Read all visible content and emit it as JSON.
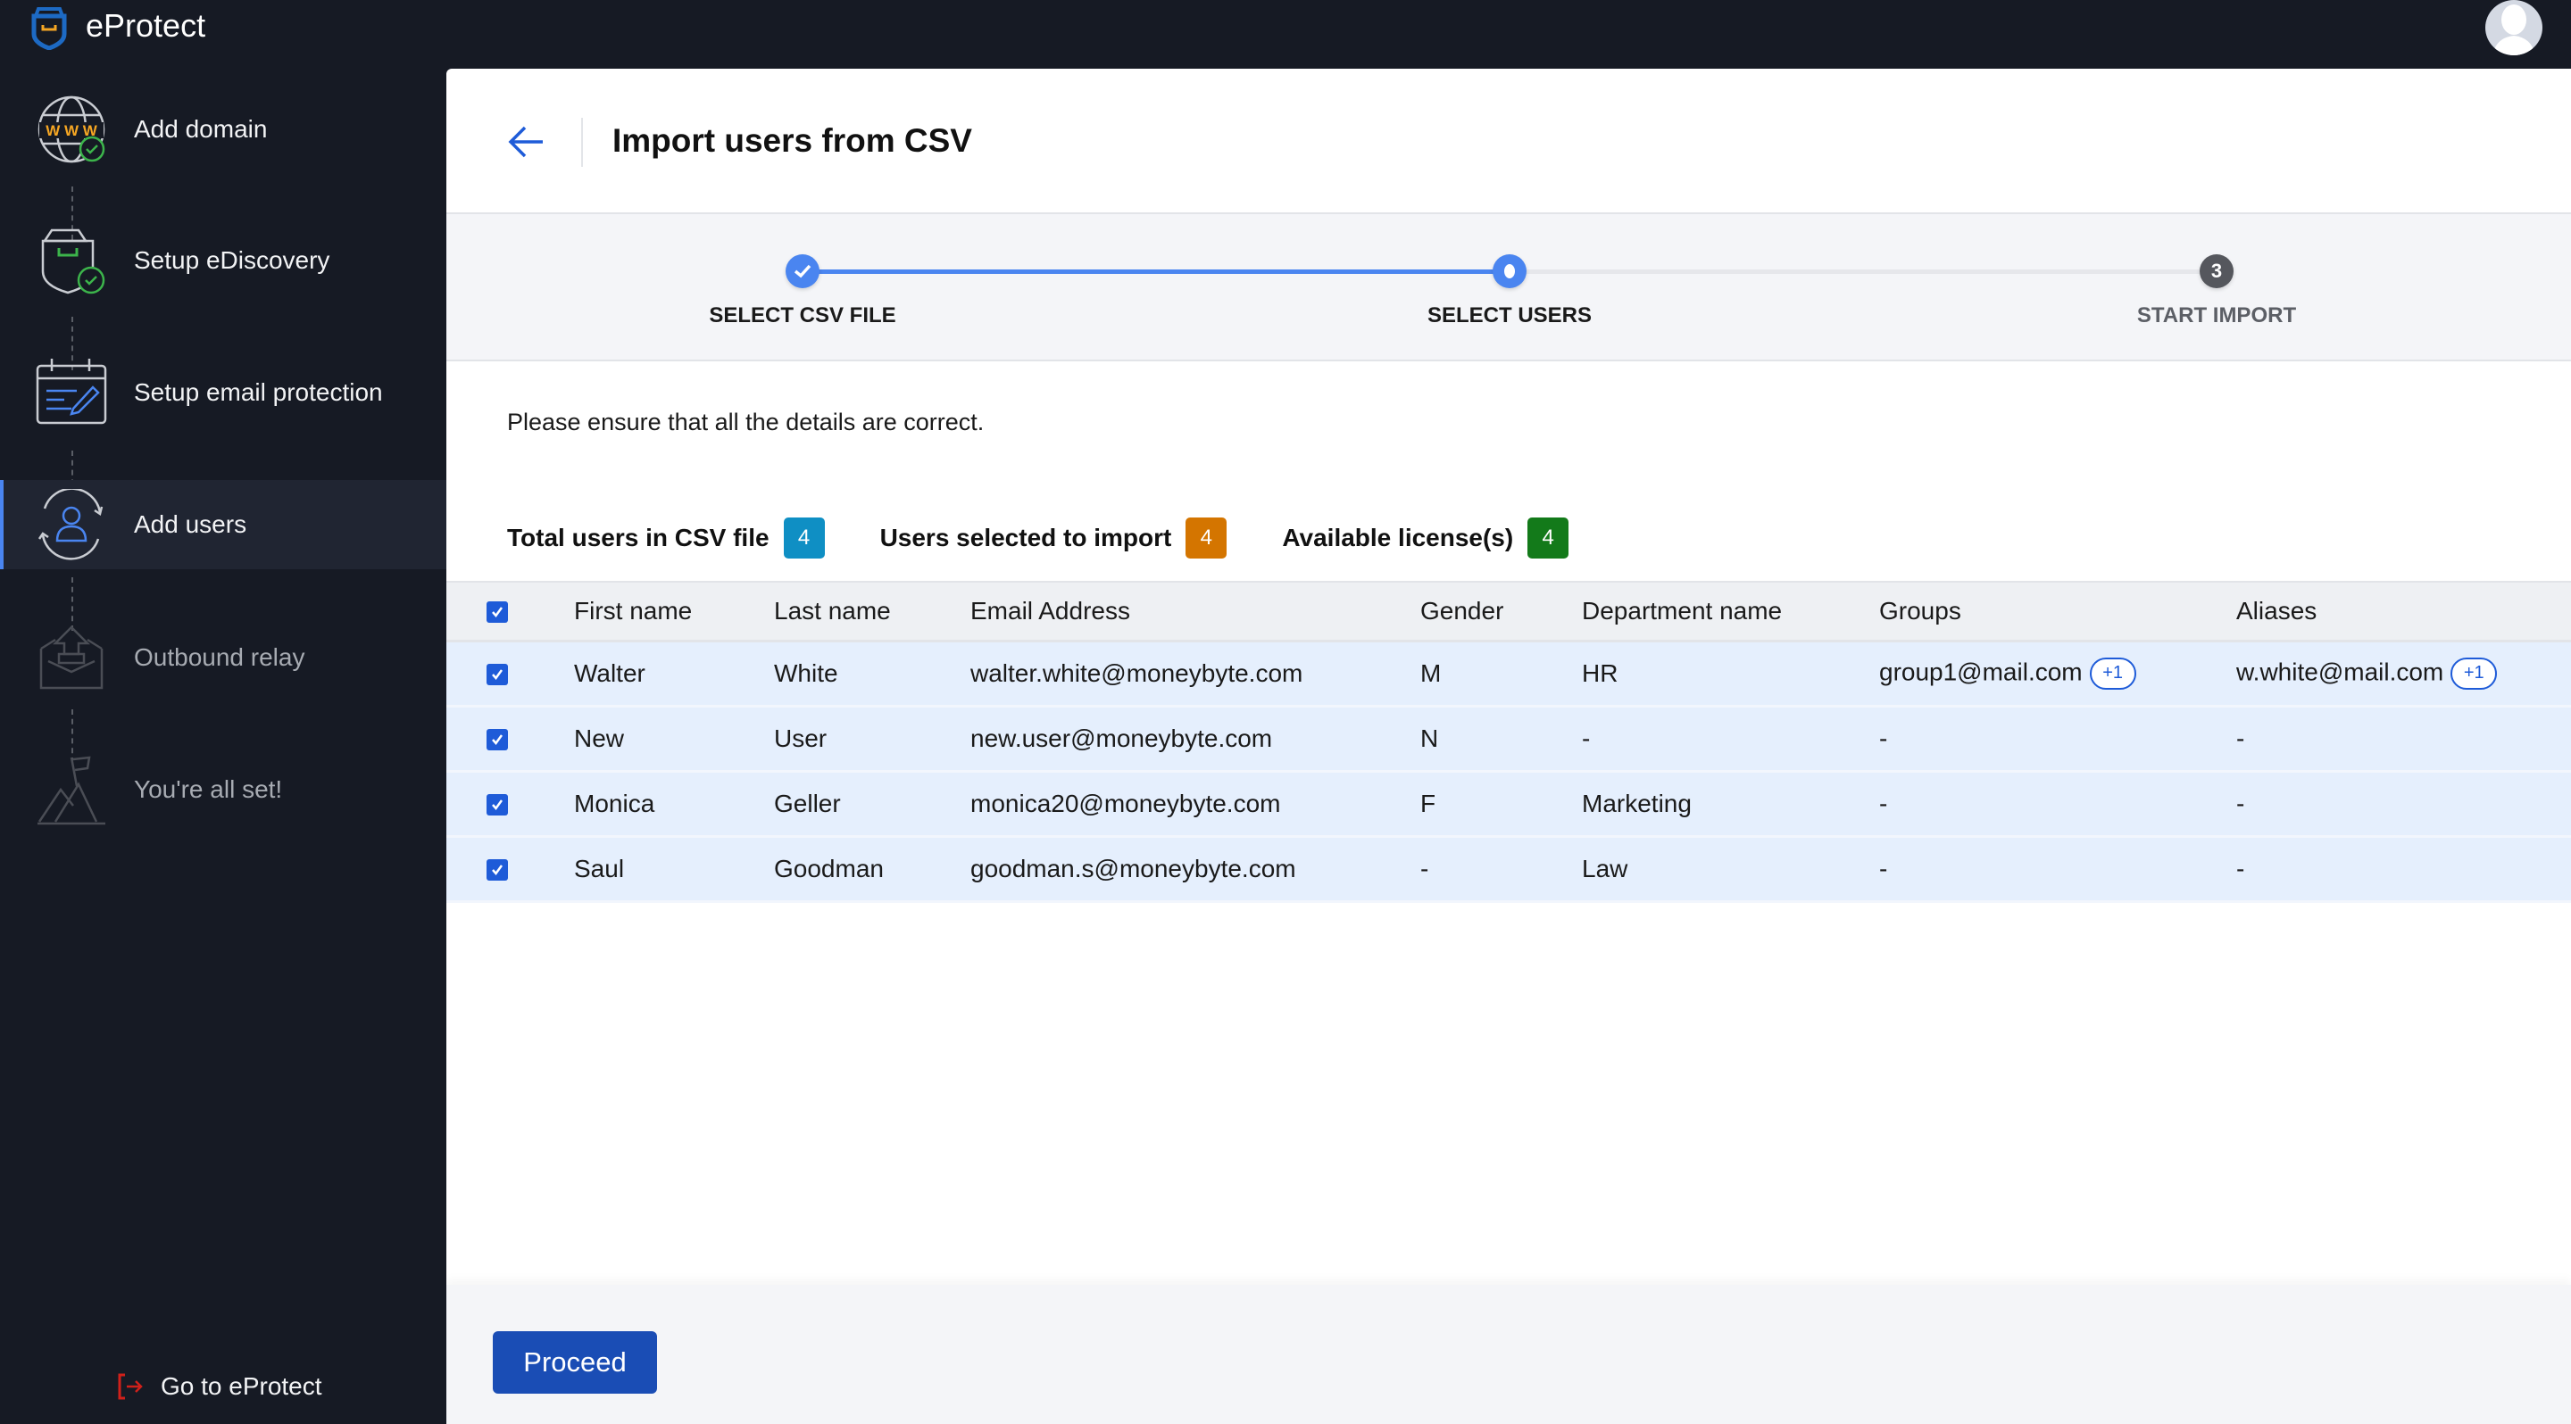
{
  "app": {
    "title": "eProtect"
  },
  "sidebar": {
    "items": [
      {
        "label": "Add domain",
        "icon": "globe-www-check-icon",
        "state": "done"
      },
      {
        "label": "Setup eDiscovery",
        "icon": "shield-check-icon",
        "state": "done"
      },
      {
        "label": "Setup email protection",
        "icon": "calendar-edit-icon",
        "state": "done"
      },
      {
        "label": "Add users",
        "icon": "user-sync-icon",
        "state": "active"
      },
      {
        "label": "Outbound relay",
        "icon": "outbox-upload-icon",
        "state": "disabled"
      },
      {
        "label": "You're all set!",
        "icon": "mountain-flag-icon",
        "state": "disabled"
      }
    ],
    "footer_link": {
      "label": "Go to eProtect",
      "icon": "exit-icon"
    }
  },
  "page": {
    "title": "Import users from CSV",
    "back_icon": "arrow-left-icon"
  },
  "stepper": {
    "steps": [
      {
        "label": "SELECT CSV FILE",
        "state": "completed"
      },
      {
        "label": "SELECT USERS",
        "state": "current"
      },
      {
        "label": "START IMPORT",
        "state": "pending",
        "number": "3"
      }
    ],
    "colors": {
      "active": "#4a85f0",
      "pending": "#55575d"
    }
  },
  "info_text": "Please ensure that all the details are correct.",
  "stats": [
    {
      "label": "Total users in CSV file",
      "value": "4",
      "color": "#0f8fc4"
    },
    {
      "label": "Users selected to import",
      "value": "4",
      "color": "#d47500"
    },
    {
      "label": "Available license(s)",
      "value": "4",
      "color": "#137a1a"
    }
  ],
  "table": {
    "all_selected": true,
    "columns": [
      "First name",
      "Last name",
      "Email Address",
      "Gender",
      "Department name",
      "Groups",
      "Aliases"
    ],
    "rows": [
      {
        "selected": true,
        "first": "Walter",
        "last": "White",
        "email": "walter.white@moneybyte.com",
        "gender": "M",
        "department": "HR",
        "groups": "group1@mail.com",
        "groups_more": "+1",
        "aliases": "w.white@mail.com",
        "aliases_more": "+1"
      },
      {
        "selected": true,
        "first": "New",
        "last": "User",
        "email": "new.user@moneybyte.com",
        "gender": "N",
        "department": "-",
        "groups": "-",
        "groups_more": null,
        "aliases": "-",
        "aliases_more": null
      },
      {
        "selected": true,
        "first": "Monica",
        "last": "Geller",
        "email": "monica20@moneybyte.com",
        "gender": "F",
        "department": "Marketing",
        "groups": "-",
        "groups_more": null,
        "aliases": "-",
        "aliases_more": null
      },
      {
        "selected": true,
        "first": "Saul",
        "last": "Goodman",
        "email": "goodman.s@moneybyte.com",
        "gender": "-",
        "department": "Law",
        "groups": "-",
        "groups_more": null,
        "aliases": "-",
        "aliases_more": null
      }
    ]
  },
  "footer": {
    "proceed_label": "Proceed"
  }
}
